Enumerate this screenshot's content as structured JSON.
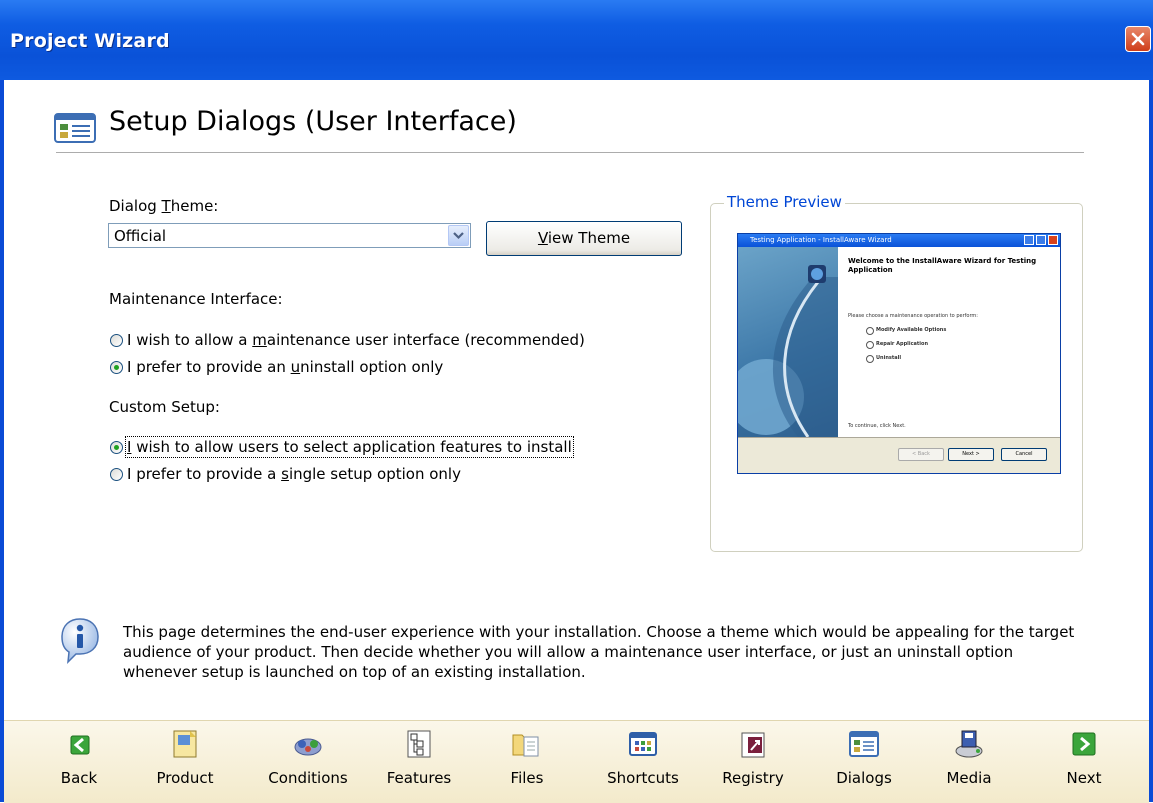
{
  "window": {
    "title": "Project Wizard"
  },
  "page": {
    "title": "Setup Dialogs (User Interface)"
  },
  "dialog_theme": {
    "label_prefix": "Dialog ",
    "label_mnemonic": "T",
    "label_rest": "heme:",
    "value": "Official",
    "view_button_prefix": "",
    "view_button_mnemonic": "V",
    "view_button_rest": "iew Theme"
  },
  "maintenance": {
    "label": "Maintenance Interface:",
    "options": [
      {
        "pre": "I wish to allow a ",
        "mn": "m",
        "post": "aintenance user interface (recommended)",
        "checked": false
      },
      {
        "pre": "I prefer to provide an ",
        "mn": "u",
        "post": "ninstall option only",
        "checked": true
      }
    ]
  },
  "custom_setup": {
    "label": "Custom Setup:",
    "options": [
      {
        "pre": "",
        "mn": "I",
        "post": " wish to allow users to select application features to install",
        "checked": true
      },
      {
        "pre": "I prefer to provide a ",
        "mn": "s",
        "post": "ingle setup option only",
        "checked": false
      }
    ]
  },
  "theme_preview": {
    "label": "Theme Preview",
    "window_title": "Testing Application - InstallAware Wizard",
    "heading": "Welcome to the InstallAware Wizard for Testing Application",
    "prompt": "Please choose a maintenance operation to perform:",
    "options": [
      "Modify Available Options",
      "Repair Application",
      "Uninstall"
    ],
    "footer": "To continue, click Next.",
    "buttons": [
      "< Back",
      "Next >",
      "Cancel"
    ]
  },
  "info": {
    "text": "This page determines the end-user experience with your installation. Choose a theme which would be appealing for the target audience of your product. Then decide whether you will allow a maintenance user interface, or just an uninstall option whenever setup is launched on top of an existing installation."
  },
  "toolbar": {
    "items": [
      {
        "label": "Back",
        "icon": "back-arrow-icon"
      },
      {
        "label": "Product",
        "icon": "product-icon"
      },
      {
        "label": "Conditions",
        "icon": "conditions-icon"
      },
      {
        "label": "Features",
        "icon": "features-icon"
      },
      {
        "label": "Files",
        "icon": "files-icon"
      },
      {
        "label": "Shortcuts",
        "icon": "shortcuts-icon"
      },
      {
        "label": "Registry",
        "icon": "registry-icon"
      },
      {
        "label": "Dialogs",
        "icon": "dialogs-icon"
      },
      {
        "label": "Media",
        "icon": "media-icon"
      },
      {
        "label": "Next",
        "icon": "next-arrow-icon"
      }
    ]
  },
  "colors": {
    "titlebar": "#0A52D8",
    "group_label": "#0046D5",
    "radio_dot": "#21A121",
    "toolbar_bg": "#F6EED4"
  }
}
